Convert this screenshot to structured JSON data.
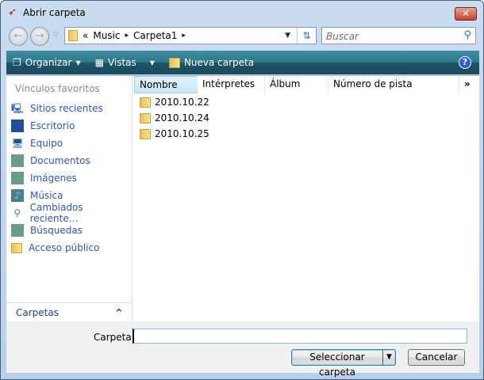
{
  "window": {
    "title": "Abrir carpeta",
    "close": "✕"
  },
  "address": {
    "chevrons": "«",
    "crumbs": [
      "Music",
      "Carpeta1"
    ],
    "sep": "▸"
  },
  "search": {
    "placeholder": "Buscar"
  },
  "toolbar": {
    "organize": "Organizar",
    "views": "Vistas",
    "new_folder": "Nueva carpeta",
    "help": "?"
  },
  "sidebar": {
    "title": "Vínculos favoritos",
    "items": [
      {
        "label": "Sitios recientes",
        "icon": "recent-places-icon"
      },
      {
        "label": "Escritorio",
        "icon": "desktop-icon"
      },
      {
        "label": "Equipo",
        "icon": "computer-icon"
      },
      {
        "label": "Documentos",
        "icon": "documents-icon"
      },
      {
        "label": "Imágenes",
        "icon": "pictures-icon"
      },
      {
        "label": "Música",
        "icon": "music-icon"
      },
      {
        "label": "Cambiados reciente...",
        "icon": "recently-changed-icon"
      },
      {
        "label": "Búsquedas",
        "icon": "searches-icon"
      },
      {
        "label": "Acceso público",
        "icon": "public-folder-icon"
      }
    ],
    "folders": "Carpetas"
  },
  "list": {
    "columns": [
      "Nombre",
      "Intérpretes",
      "Álbum",
      "Número de pista"
    ],
    "more": "»",
    "items": [
      "2010.10.22",
      "2010.10.24",
      "2010.10.25"
    ]
  },
  "footer": {
    "folder_label": "Carpeta:",
    "folder_value": "",
    "select": "Seleccionar carpeta",
    "cancel": "Cancelar"
  }
}
